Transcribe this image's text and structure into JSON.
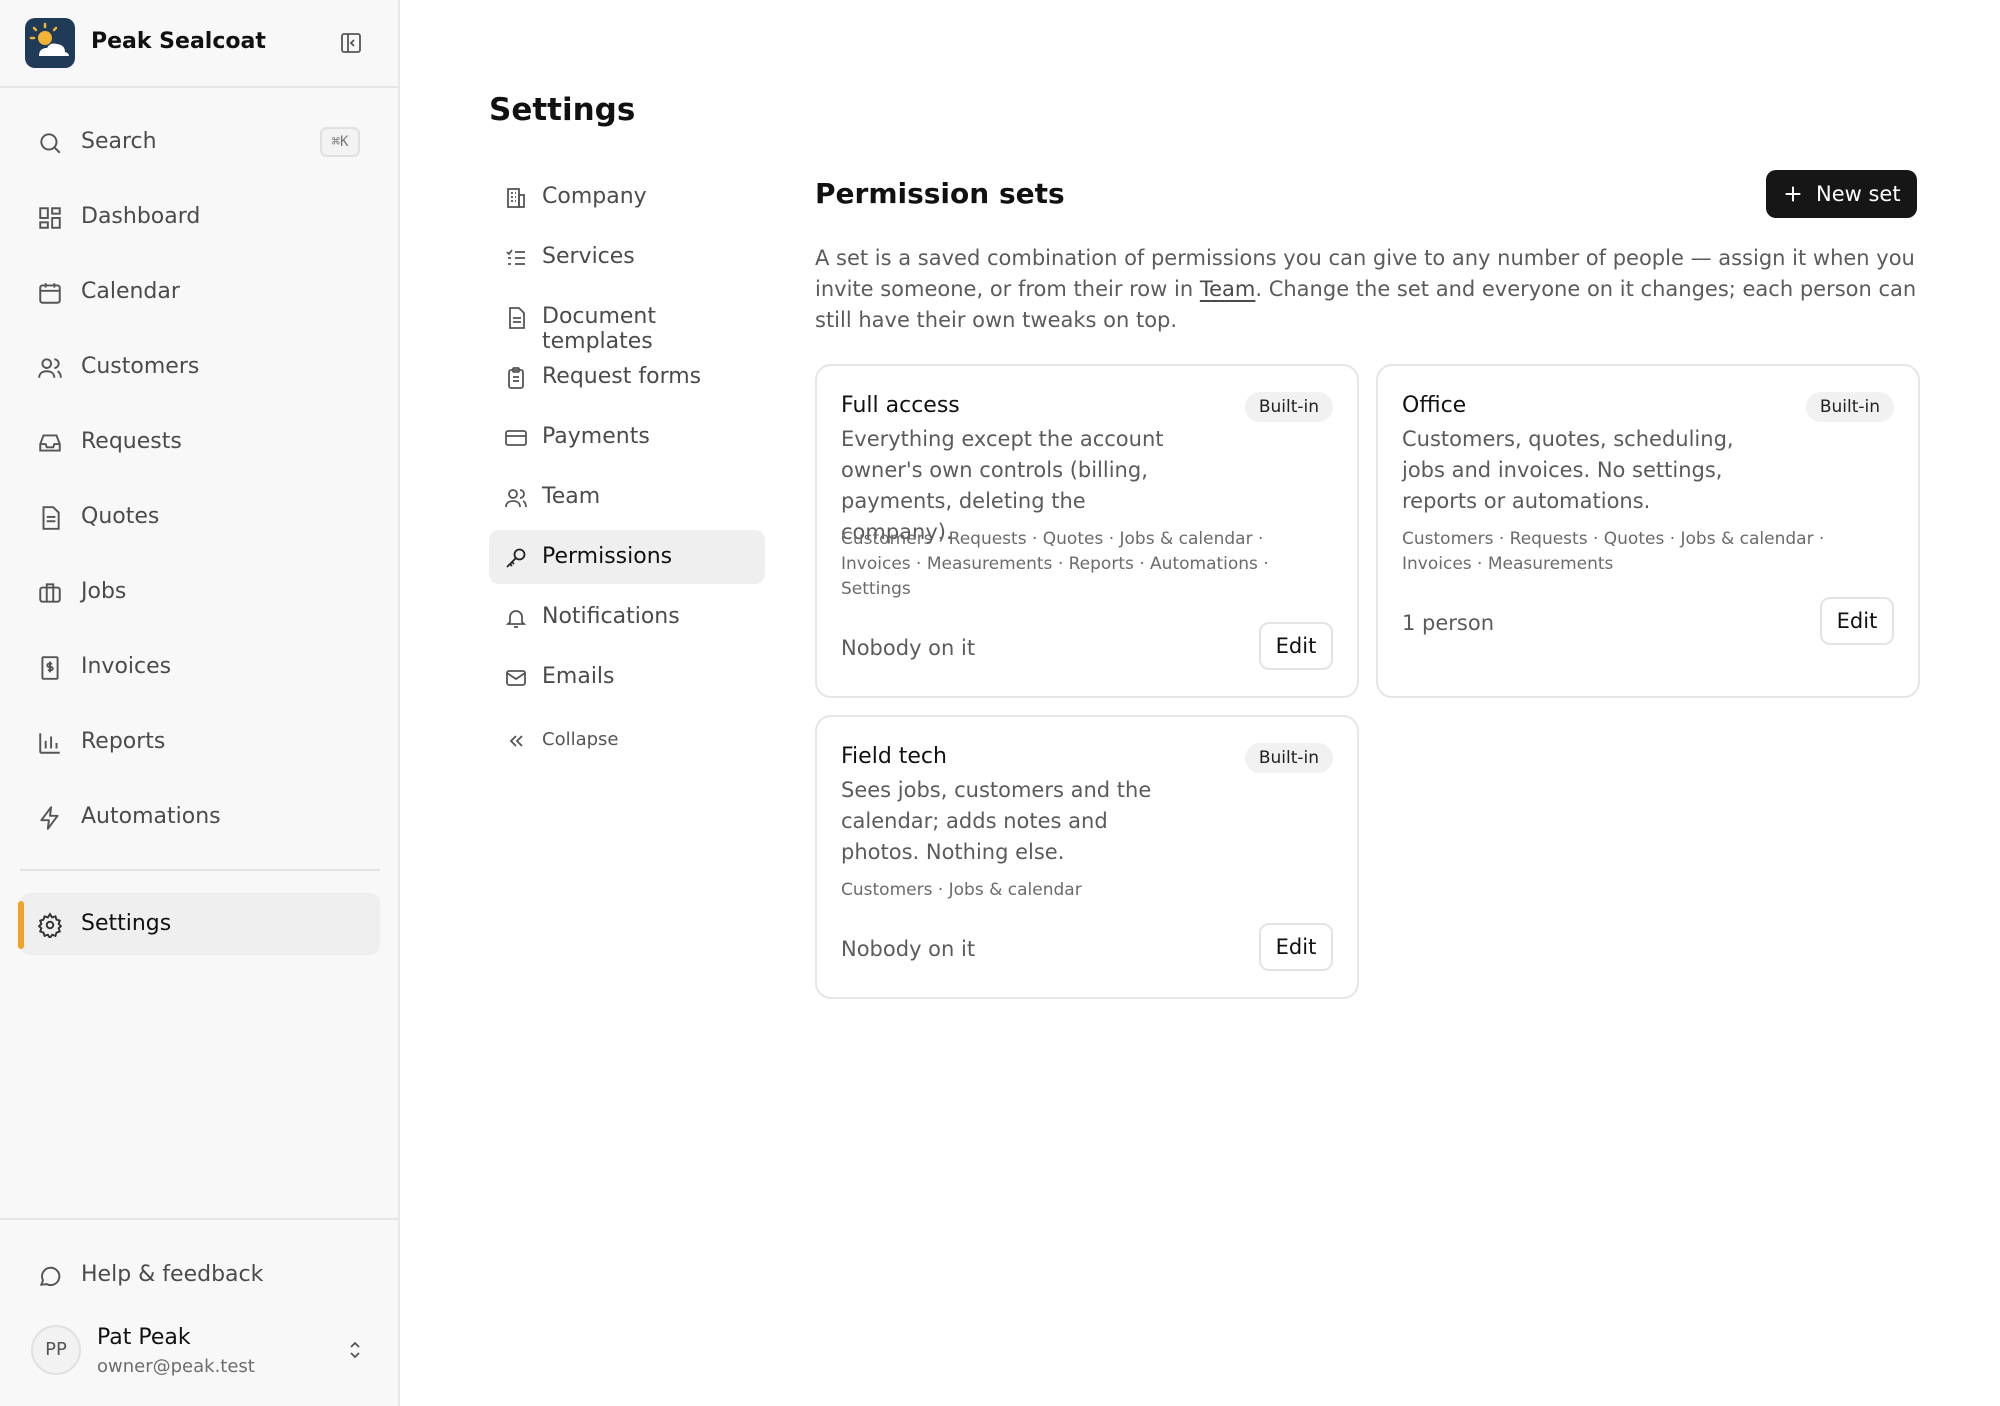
{
  "app": {
    "name": "Peak Sealcoat"
  },
  "colors": {
    "accent": "#f0a32a",
    "primary_button": "#161616",
    "logo_bg": "#1f3b57"
  },
  "sidebar": {
    "search": {
      "label": "Search",
      "shortcut": "⌘K",
      "icon": "search-icon"
    },
    "items": [
      {
        "label": "Dashboard",
        "icon": "dashboard-icon"
      },
      {
        "label": "Calendar",
        "icon": "calendar-icon"
      },
      {
        "label": "Customers",
        "icon": "users-icon"
      },
      {
        "label": "Requests",
        "icon": "inbox-icon"
      },
      {
        "label": "Quotes",
        "icon": "document-icon"
      },
      {
        "label": "Jobs",
        "icon": "briefcase-icon"
      },
      {
        "label": "Invoices",
        "icon": "invoice-icon"
      },
      {
        "label": "Reports",
        "icon": "bar-chart-icon"
      },
      {
        "label": "Automations",
        "icon": "lightning-icon"
      }
    ],
    "settings": {
      "label": "Settings",
      "icon": "gear-icon",
      "active": true
    },
    "help": {
      "label": "Help & feedback",
      "icon": "chat-bubble-icon"
    },
    "user": {
      "initials": "PP",
      "name": "Pat Peak",
      "email": "owner@peak.test"
    }
  },
  "settings_page": {
    "title": "Settings",
    "subnav": [
      {
        "label": "Company",
        "icon": "building-icon"
      },
      {
        "label": "Services",
        "icon": "checklist-icon"
      },
      {
        "label": "Document templates",
        "icon": "file-icon"
      },
      {
        "label": "Request forms",
        "icon": "clipboard-icon"
      },
      {
        "label": "Payments",
        "icon": "credit-card-icon"
      },
      {
        "label": "Team",
        "icon": "team-icon"
      },
      {
        "label": "Permissions",
        "icon": "key-icon",
        "active": true
      },
      {
        "label": "Notifications",
        "icon": "bell-icon"
      },
      {
        "label": "Emails",
        "icon": "mail-icon"
      },
      {
        "label": "Collapse",
        "icon": "double-chevron-left-icon"
      }
    ]
  },
  "permissions": {
    "title": "Permission sets",
    "new_button": "New set",
    "intro_before": "A set is a saved combination of permissions you can give to any number of people — assign it when you invite someone, or from their row in ",
    "intro_link": "Team",
    "intro_after": ". Change the set and everyone on it changes; each person can still have their own tweaks on top.",
    "sets": [
      {
        "name": "Full access",
        "badge": "Built-in",
        "description": "Everything except the account owner's own controls (billing, payments, deleting the company).",
        "permissions": "Customers · Requests · Quotes · Jobs & calendar · Invoices · Measurements · Reports · Automations · Settings",
        "members": "Nobody on it",
        "edit_label": "Edit"
      },
      {
        "name": "Office",
        "badge": "Built-in",
        "description": "Customers, quotes, scheduling, jobs and invoices. No settings, reports or automations.",
        "permissions": "Customers · Requests · Quotes · Jobs & calendar · Invoices · Measurements",
        "members": "1 person",
        "edit_label": "Edit"
      },
      {
        "name": "Field tech",
        "badge": "Built-in",
        "description": "Sees jobs, customers and the calendar; adds notes and photos. Nothing else.",
        "permissions": "Customers · Jobs & calendar",
        "members": "Nobody on it",
        "edit_label": "Edit"
      }
    ]
  }
}
